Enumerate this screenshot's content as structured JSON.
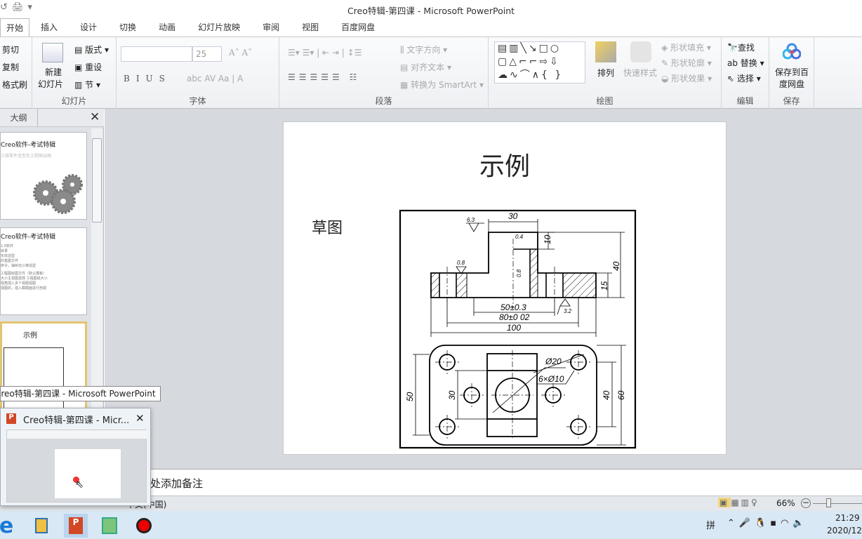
{
  "window": {
    "title": "Creo特辑-第四课  -  Microsoft PowerPoint"
  },
  "qat": {
    "undo": "↺",
    "print": "🖨",
    "customize": "▾"
  },
  "tabs": [
    "开始",
    "插入",
    "设计",
    "切换",
    "动画",
    "幻灯片放映",
    "审阅",
    "视图",
    "百度网盘"
  ],
  "ribbon": {
    "clipboard": {
      "cut": "剪切",
      "copy": "复制",
      "painter": "格式刷"
    },
    "slides": {
      "label": "幻灯片",
      "new_line1": "新建",
      "new_line2": "幻灯片",
      "layout": "版式",
      "reset": "重设",
      "section": "节"
    },
    "font": {
      "label": "字体",
      "font_name": "",
      "font_size": "25"
    },
    "paragraph": {
      "label": "段落",
      "text_direction": "文字方向",
      "align_text": "对齐文本",
      "smartart": "转换为 SmartArt"
    },
    "drawing": {
      "label": "绘图",
      "arrange": "排列",
      "quick_styles": "快速样式",
      "shape_fill": "形状填充",
      "shape_outline": "形状轮廓",
      "shape_effects": "形状效果"
    },
    "editing": {
      "label": "编辑",
      "find": "查找",
      "replace": "替换",
      "select": "选择"
    },
    "save": {
      "label": "保存",
      "save_to_baidu_line1": "保存到百",
      "save_to_baidu_line2": "度网盘"
    }
  },
  "panel": {
    "outline_tab": "大纲",
    "thumbs": [
      {
        "title": "Creo软件-考试特辑",
        "subtitle": "三维零件造型及工程图出图"
      },
      {
        "title": "Creo软件-考试特辑",
        "lines": [
          "1.0软件",
          "目录",
          "实体造型",
          "的基图文件",
          "命令，抽树也三维造型",
          "工程图绘图文件（默认模板）",
          "大小主视图选择 工程图纸大小",
          "视角插入多个视图视图",
          "视图的，插入截截面进行剖视"
        ]
      },
      {
        "title": "示例"
      }
    ]
  },
  "slide": {
    "title": "示例",
    "label": "草图",
    "dims": {
      "d30": "30",
      "d10": "10",
      "d40": "40",
      "d15": "15",
      "d50": "50±0.3",
      "d80": "80±0 02",
      "d100": "100",
      "r63": "6.3",
      "r04": "0.4",
      "r08a": "0.8",
      "r08b": "0.8",
      "r32": "3.2",
      "phi20": "Ø20",
      "holes": "6×Ø10",
      "v50": "50",
      "v30": "30",
      "v40": "40",
      "v60": "60"
    }
  },
  "notes": {
    "placeholder": "单击此处添加备注"
  },
  "status": {
    "language": "中文(中国)",
    "zoom": "66%",
    "zoom_fraction": 0.66
  },
  "tooltip": "Creo特辑-第四课 - Microsoft PowerPoint",
  "preview": {
    "title": "Creo特辑-第四课 - Micr...",
    "close": "✕"
  },
  "taskbar": {
    "ime": "拼",
    "time": "21:29",
    "date": "2020/12/"
  }
}
